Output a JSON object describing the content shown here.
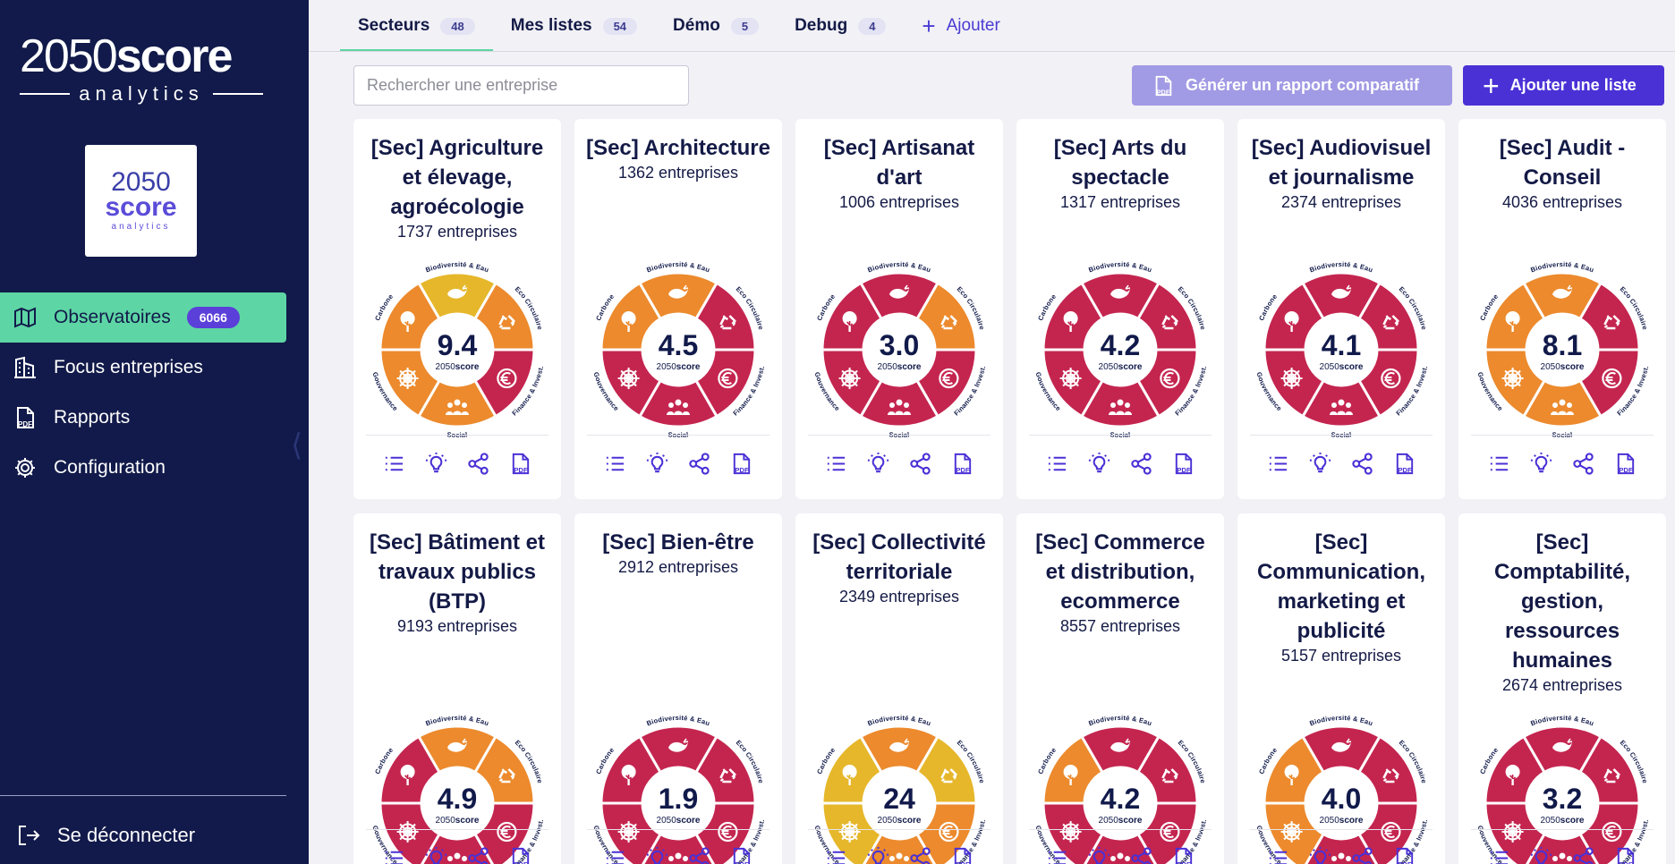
{
  "brand": {
    "main_num": "2050",
    "main_word": "score",
    "sub": "analytics"
  },
  "logo_tile": {
    "l1": "2050",
    "l2": "score",
    "l3": "analytics"
  },
  "sidebar": {
    "items": [
      {
        "label": "Observatoires",
        "badge": "6066",
        "icon": "map-icon",
        "active": true
      },
      {
        "label": "Focus entreprises",
        "icon": "buildings-icon"
      },
      {
        "label": "Rapports",
        "icon": "pdf-icon"
      },
      {
        "label": "Configuration",
        "icon": "gear-icon"
      }
    ],
    "logout": "Se déconnecter"
  },
  "tabs": [
    {
      "label": "Secteurs",
      "count": "48"
    },
    {
      "label": "Mes listes",
      "count": "54"
    },
    {
      "label": "Démo",
      "count": "5"
    },
    {
      "label": "Debug",
      "count": "4"
    }
  ],
  "add_tab": "Ajouter",
  "toolbar": {
    "search_placeholder": "Rechercher une entreprise",
    "report_label": "Générer un rapport comparatif",
    "add_list_label": "Ajouter une liste",
    "pdf_text": "PDF"
  },
  "wheel_labels": {
    "top": "Biodiversité & Eau",
    "tr": "Eco Circulaire",
    "br": "Finance & Invest.",
    "bottom": "Social",
    "bl": "Gouvernance",
    "tl": "Carbone",
    "brand_num": "2050",
    "brand_word": "score"
  },
  "palette": {
    "red": "#c4254f",
    "orange": "#ec8a2d",
    "yellow": "#e6b72b",
    "navy": "#111a4a",
    "green": "#5ed5a4",
    "purple": "#4a31d6"
  },
  "cards": [
    {
      "title": "[Sec] Agriculture et élevage, agroécologie",
      "count": "1737 entreprises",
      "score": "9.4",
      "colors": [
        "yellow",
        "orange",
        "red",
        "orange",
        "orange",
        "orange"
      ]
    },
    {
      "title": "[Sec] Architecture",
      "count": "1362 entreprises",
      "score": "4.5",
      "colors": [
        "orange",
        "red",
        "red",
        "red",
        "red",
        "orange"
      ]
    },
    {
      "title": "[Sec] Artisanat d'art",
      "count": "1006 entreprises",
      "score": "3.0",
      "colors": [
        "red",
        "orange",
        "red",
        "red",
        "red",
        "red"
      ]
    },
    {
      "title": "[Sec] Arts du spectacle",
      "count": "1317 entreprises",
      "score": "4.2",
      "colors": [
        "red",
        "red",
        "red",
        "red",
        "red",
        "red"
      ]
    },
    {
      "title": "[Sec] Audiovisuel et journalisme",
      "count": "2374 entreprises",
      "score": "4.1",
      "colors": [
        "red",
        "red",
        "red",
        "red",
        "red",
        "red"
      ]
    },
    {
      "title": "[Sec] Audit - Conseil",
      "count": "4036 entreprises",
      "score": "8.1",
      "colors": [
        "orange",
        "red",
        "red",
        "orange",
        "orange",
        "orange"
      ]
    },
    {
      "title": "[Sec] Bâtiment et travaux publics (BTP)",
      "count": "9193 entreprises",
      "score": "4.9",
      "colors": [
        "orange",
        "orange",
        "red",
        "red",
        "red",
        "red"
      ]
    },
    {
      "title": "[Sec] Bien-être",
      "count": "2912 entreprises",
      "score": "1.9",
      "colors": [
        "red",
        "red",
        "red",
        "red",
        "red",
        "red"
      ]
    },
    {
      "title": "[Sec] Collectivité territoriale",
      "count": "2349 entreprises",
      "score": "24",
      "colors": [
        "orange",
        "yellow",
        "orange",
        "orange",
        "yellow",
        "yellow"
      ]
    },
    {
      "title": "[Sec] Commerce et distribution, ecommerce",
      "count": "8557 entreprises",
      "score": "4.2",
      "colors": [
        "red",
        "red",
        "red",
        "red",
        "red",
        "orange"
      ]
    },
    {
      "title": "[Sec] Communication, marketing et publicité",
      "count": "5157 entreprises",
      "score": "4.0",
      "colors": [
        "red",
        "red",
        "red",
        "red",
        "orange",
        "orange"
      ]
    },
    {
      "title": "[Sec] Comptabilité, gestion, ressources humaines",
      "count": "2674 entreprises",
      "score": "3.2",
      "colors": [
        "red",
        "red",
        "red",
        "red",
        "red",
        "red"
      ]
    }
  ]
}
